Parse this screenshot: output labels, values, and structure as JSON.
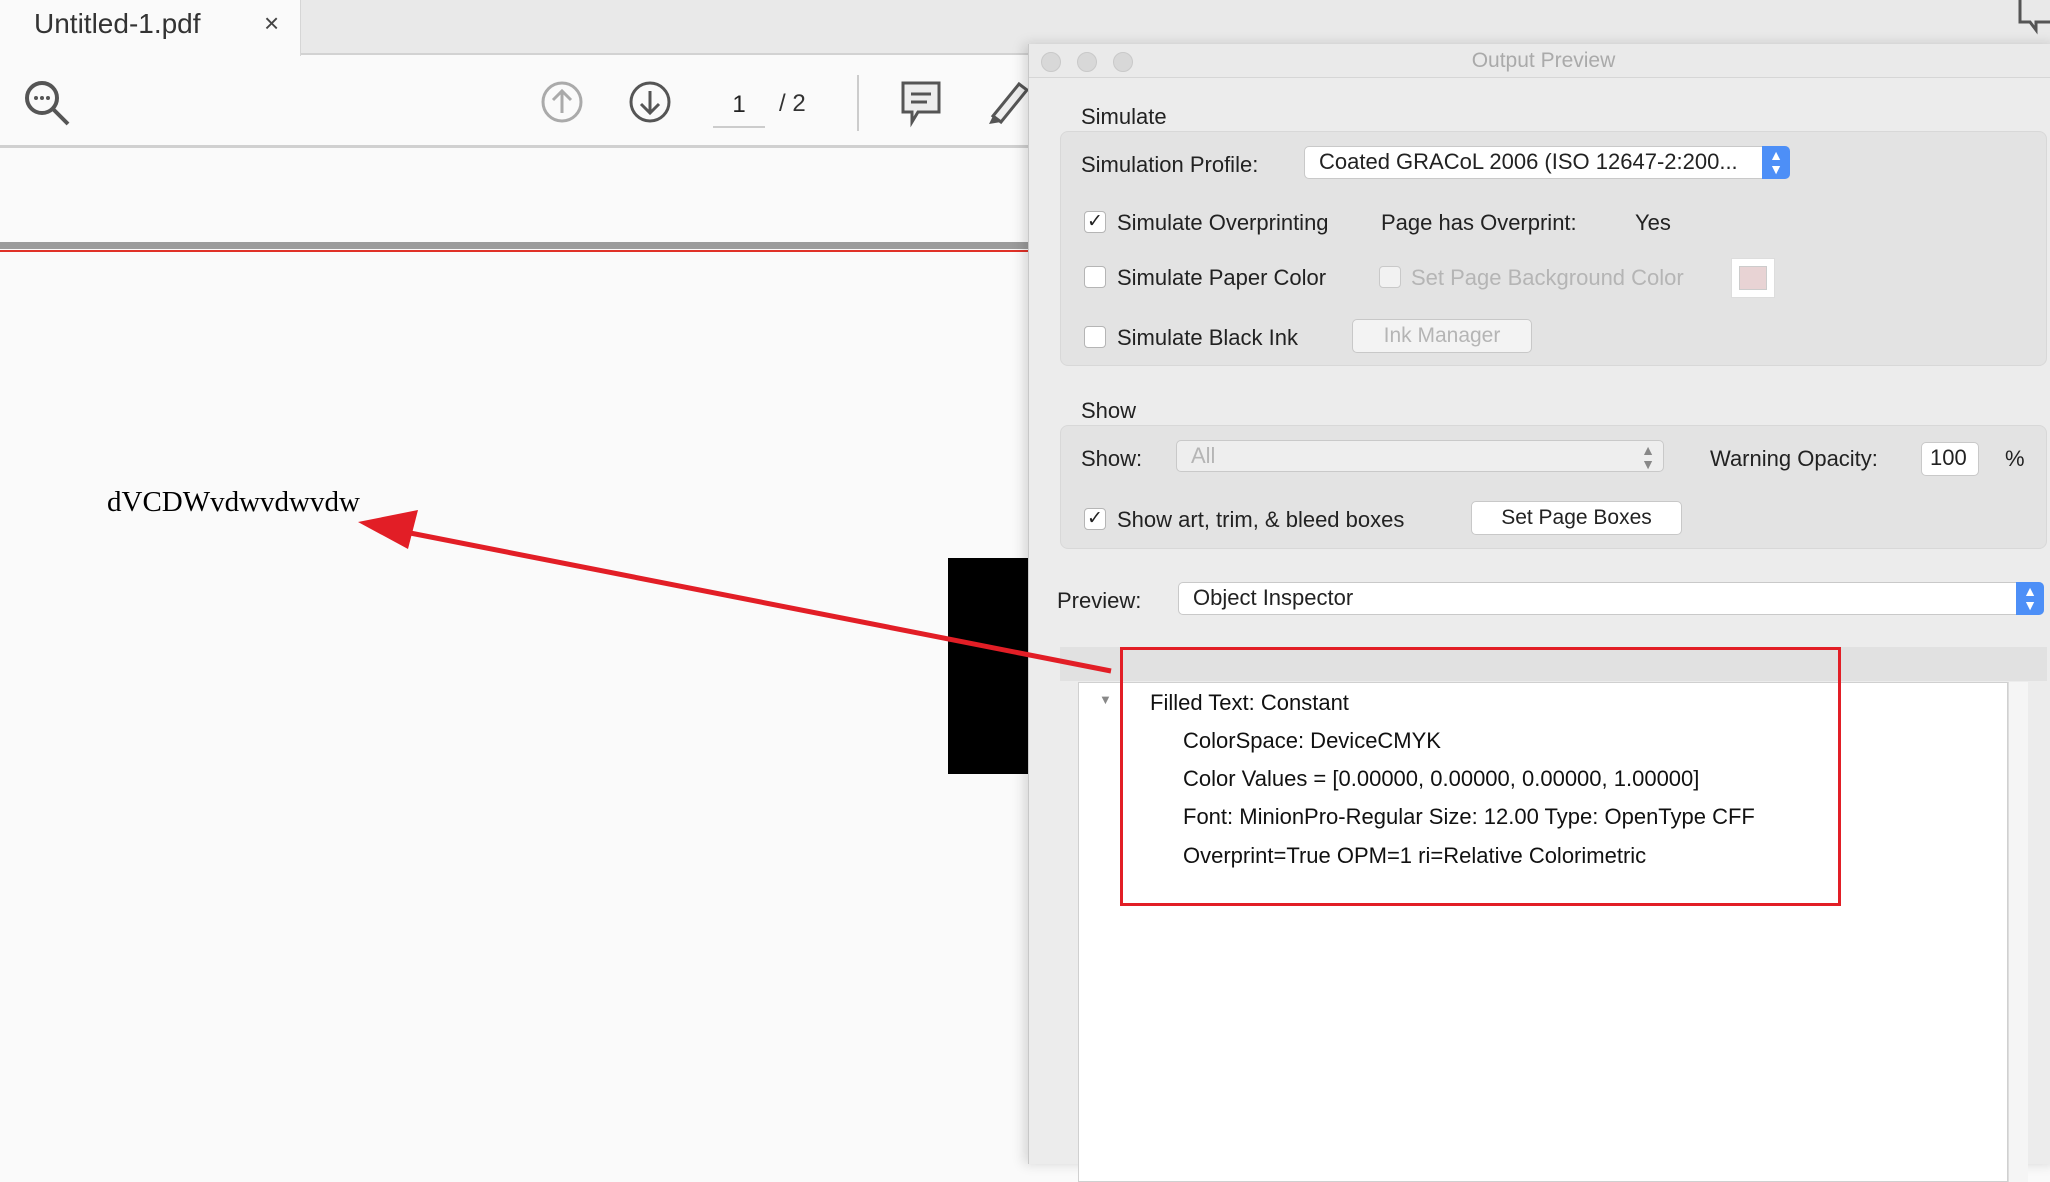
{
  "tab": {
    "title": "Untitled-1.pdf",
    "close": "×"
  },
  "toolbar": {
    "icons": [
      "zoom-icon",
      "page-up-icon",
      "page-down-icon",
      "comment-icon",
      "pen-icon"
    ],
    "page_current": "1",
    "page_total": "/ 2"
  },
  "document": {
    "text": "dVCDWvdwvdwvdw",
    "annotation_color": "#e21e26"
  },
  "dialog": {
    "title": "Output Preview",
    "simulate": {
      "section": "Simulate",
      "profile_label": "Simulation Profile:",
      "profile_value": "Coated GRACoL 2006 (ISO 12647-2:200...",
      "overprinting_label": "Simulate Overprinting",
      "overprinting_checked": true,
      "page_overprint_label": "Page has Overprint:",
      "page_overprint_value": "Yes",
      "paper_color_label": "Simulate Paper Color",
      "paper_color_checked": false,
      "bg_color_label": "Set Page Background Color",
      "bg_color_checked": false,
      "bg_swatch": "#e8d3d4",
      "black_ink_label": "Simulate Black Ink",
      "black_ink_checked": false,
      "ink_manager": "Ink Manager"
    },
    "show": {
      "section": "Show",
      "show_label": "Show:",
      "show_value": "All",
      "opacity_label": "Warning Opacity:",
      "opacity_value": "100",
      "percent": "%",
      "boxes_label": "Show art, trim, & bleed boxes",
      "boxes_checked": true,
      "set_boxes": "Set Page Boxes"
    },
    "preview": {
      "label": "Preview:",
      "value": "Object Inspector"
    },
    "inspector": {
      "root": "Filled Text: Constant",
      "children": [
        "ColorSpace: DeviceCMYK",
        "Color Values = [0.00000, 0.00000, 0.00000, 1.00000]",
        "Font: MinionPro-Regular Size: 12.00 Type: OpenType CFF",
        "Overprint=True OPM=1 ri=Relative Colorimetric"
      ]
    }
  }
}
